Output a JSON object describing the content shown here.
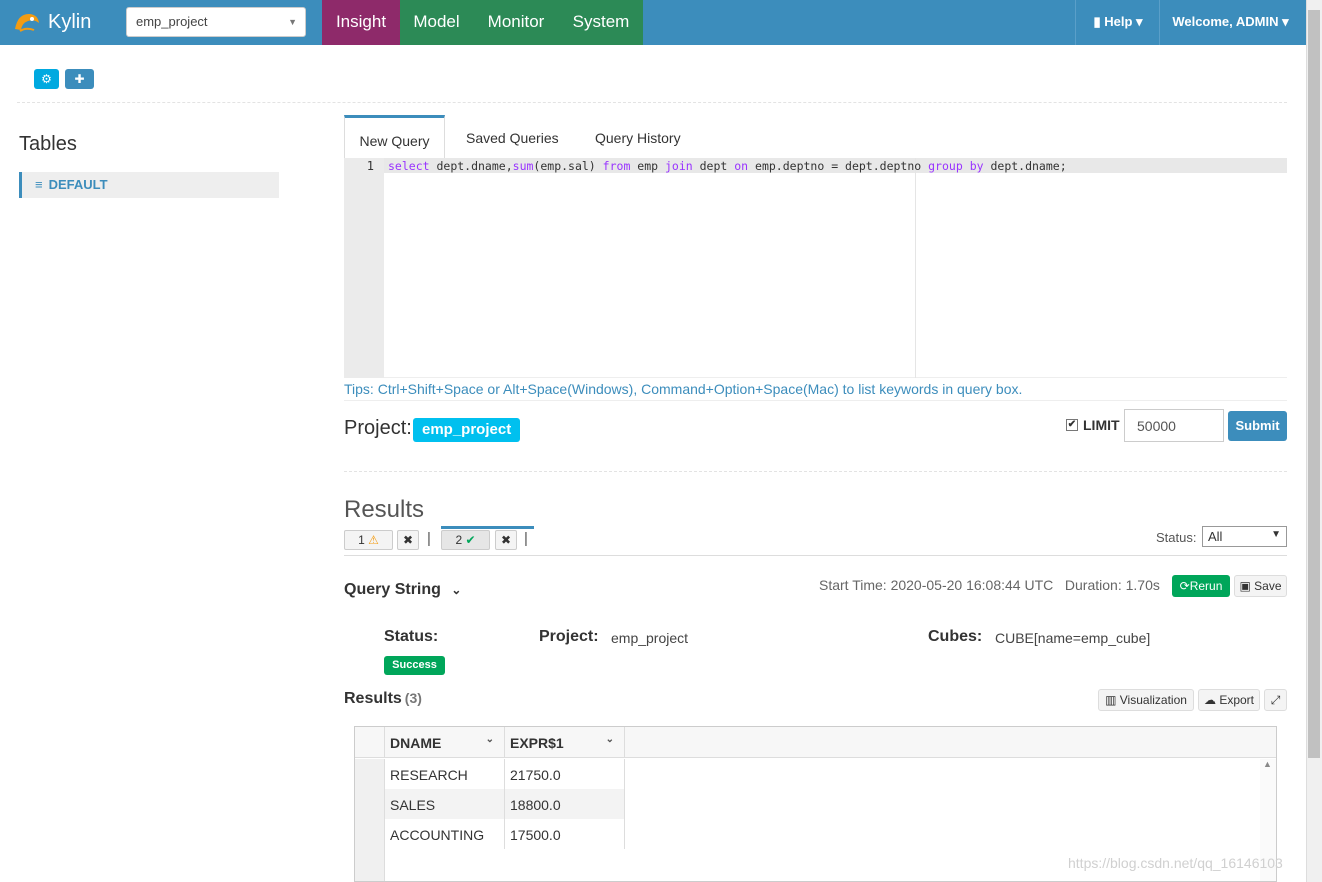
{
  "header": {
    "logo_text": "Kylin",
    "project_select": "emp_project",
    "nav": [
      "Insight",
      "Model",
      "Monitor",
      "System"
    ],
    "help": "Help",
    "welcome": "Welcome, ADMIN"
  },
  "sidebar": {
    "title": "Tables",
    "item": "DEFAULT"
  },
  "query": {
    "tabs": [
      "New Query",
      "Saved Queries",
      "Query History"
    ],
    "line_number": "1",
    "sql": "select dept.dname,sum(emp.sal) from emp join dept on emp.deptno = dept.deptno group by dept.dname;",
    "tips": "Tips: Ctrl+Shift+Space or Alt+Space(Windows), Command+Option+Space(Mac) to list keywords in query box.",
    "project_label": "Project:",
    "project_badge": "emp_project",
    "limit_label": "LIMIT",
    "limit_value": "50000",
    "submit": "Submit"
  },
  "results": {
    "title": "Results",
    "tab1": "1",
    "tab2": "2",
    "status_label": "Status:",
    "status_value": "All",
    "query_string": "Query String",
    "start_time": "Start Time: 2020-05-20 16:08:44 UTC",
    "duration": "Duration: 1.70s",
    "rerun": "Rerun",
    "save": "Save",
    "status_field": "Status:",
    "status_badge": "Success",
    "project_field": "Project:",
    "project_value": "emp_project",
    "cubes_field": "Cubes:",
    "cubes_value": "CUBE[name=emp_cube]",
    "results_label": "Results",
    "results_count": "(3)",
    "visualization": "Visualization",
    "export": "Export",
    "columns": [
      "DNAME",
      "EXPR$1"
    ],
    "rows": [
      [
        "RESEARCH",
        "21750.0"
      ],
      [
        "SALES",
        "18800.0"
      ],
      [
        "ACCOUNTING",
        "17500.0"
      ]
    ]
  },
  "watermark": "https://blog.csdn.net/qq_16146103"
}
